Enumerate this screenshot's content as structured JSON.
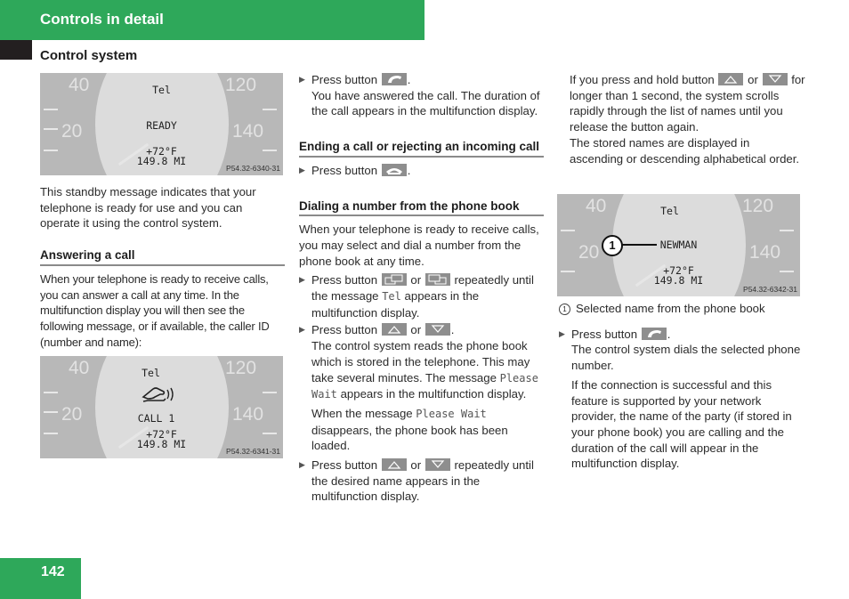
{
  "header": {
    "title": "Controls in detail",
    "color": "#2ea85a"
  },
  "section_title": "Control system",
  "page_number": "142",
  "displays": [
    {
      "id": "standby",
      "label_top": "Tel",
      "status": "READY",
      "temp": "+72°F",
      "odometer": "149.8 MI",
      "code": "P54.32-6340-31",
      "speed_labels": [
        "40",
        "20",
        "120",
        "140"
      ]
    },
    {
      "id": "incoming",
      "label_top": "Tel",
      "status": "CALL 1",
      "icon": "ringing-phone-icon",
      "temp": "+72°F",
      "odometer": "149.8 MI",
      "code": "P54.32-6341-31",
      "speed_labels": [
        "40",
        "20",
        "120",
        "140"
      ]
    },
    {
      "id": "phonebook",
      "label_top": "Tel",
      "status": "NEWMAN",
      "callout": "1",
      "temp": "+72°F",
      "odometer": "149.8 MI",
      "code": "P54.32-6342-31",
      "speed_labels": [
        "40",
        "20",
        "120",
        "140"
      ]
    }
  ],
  "col1": {
    "standby_text": "This standby message indicates that your telephone is ready for use and you can operate it using the control system.",
    "answering_heading": "Answering a call",
    "answering_text": "When your telephone is ready to receive calls, you can answer a call at any time. In the multifunction display you will then see the following message, or if available, the caller ID (number and name):"
  },
  "col2": {
    "step1_press": "Press button",
    "step1_text": "You have answered the call. The duration of the call appears in the multifunction display.",
    "ending_heading": "Ending a call or rejecting an incoming call",
    "step2_press": "Press button",
    "dialing_heading": "Dialing a number from the phone book",
    "dialing_text": "When your telephone is ready to receive calls, you may select and dial a number from the phone book at any time.",
    "step3_press": "Press button",
    "or": "or",
    "step3_rest_a": "repeatedly until the message",
    "step3_mono": "Tel",
    "step3_rest_b": "appears in the multifunction display.",
    "step4_press": "Press button",
    "step4_text_a": "The control system reads the phone book which is stored in the telephone. This may take several minutes. The message",
    "step4_mono1": "Please Wait",
    "step4_text_b": "appears in the multifunction display.",
    "step4_text_c": "When the message",
    "step4_mono2": "Please Wait",
    "step4_text_d": "disappears, the phone book has been loaded.",
    "step5_press": "Press button",
    "step5_rest": "repeatedly until the desired name appears in the multifunction display."
  },
  "col3": {
    "hold_a": "If you press and hold button",
    "or": "or",
    "hold_b": "for longer than 1 second, the system scrolls rapidly through the list of names until you release the button again.",
    "hold_c": "The stored names are displayed in ascending or descending alphabetical order.",
    "legend_num": "1",
    "legend_text": "Selected name from the phone book",
    "step_press": "Press button",
    "step_text": "The control system dials the selected phone number.",
    "final_text": "If the connection is successful and this feature is supported by your network provider, the name of the party (if stored in your phone book) you are calling and the duration of the call will appear in the multifunction display."
  }
}
